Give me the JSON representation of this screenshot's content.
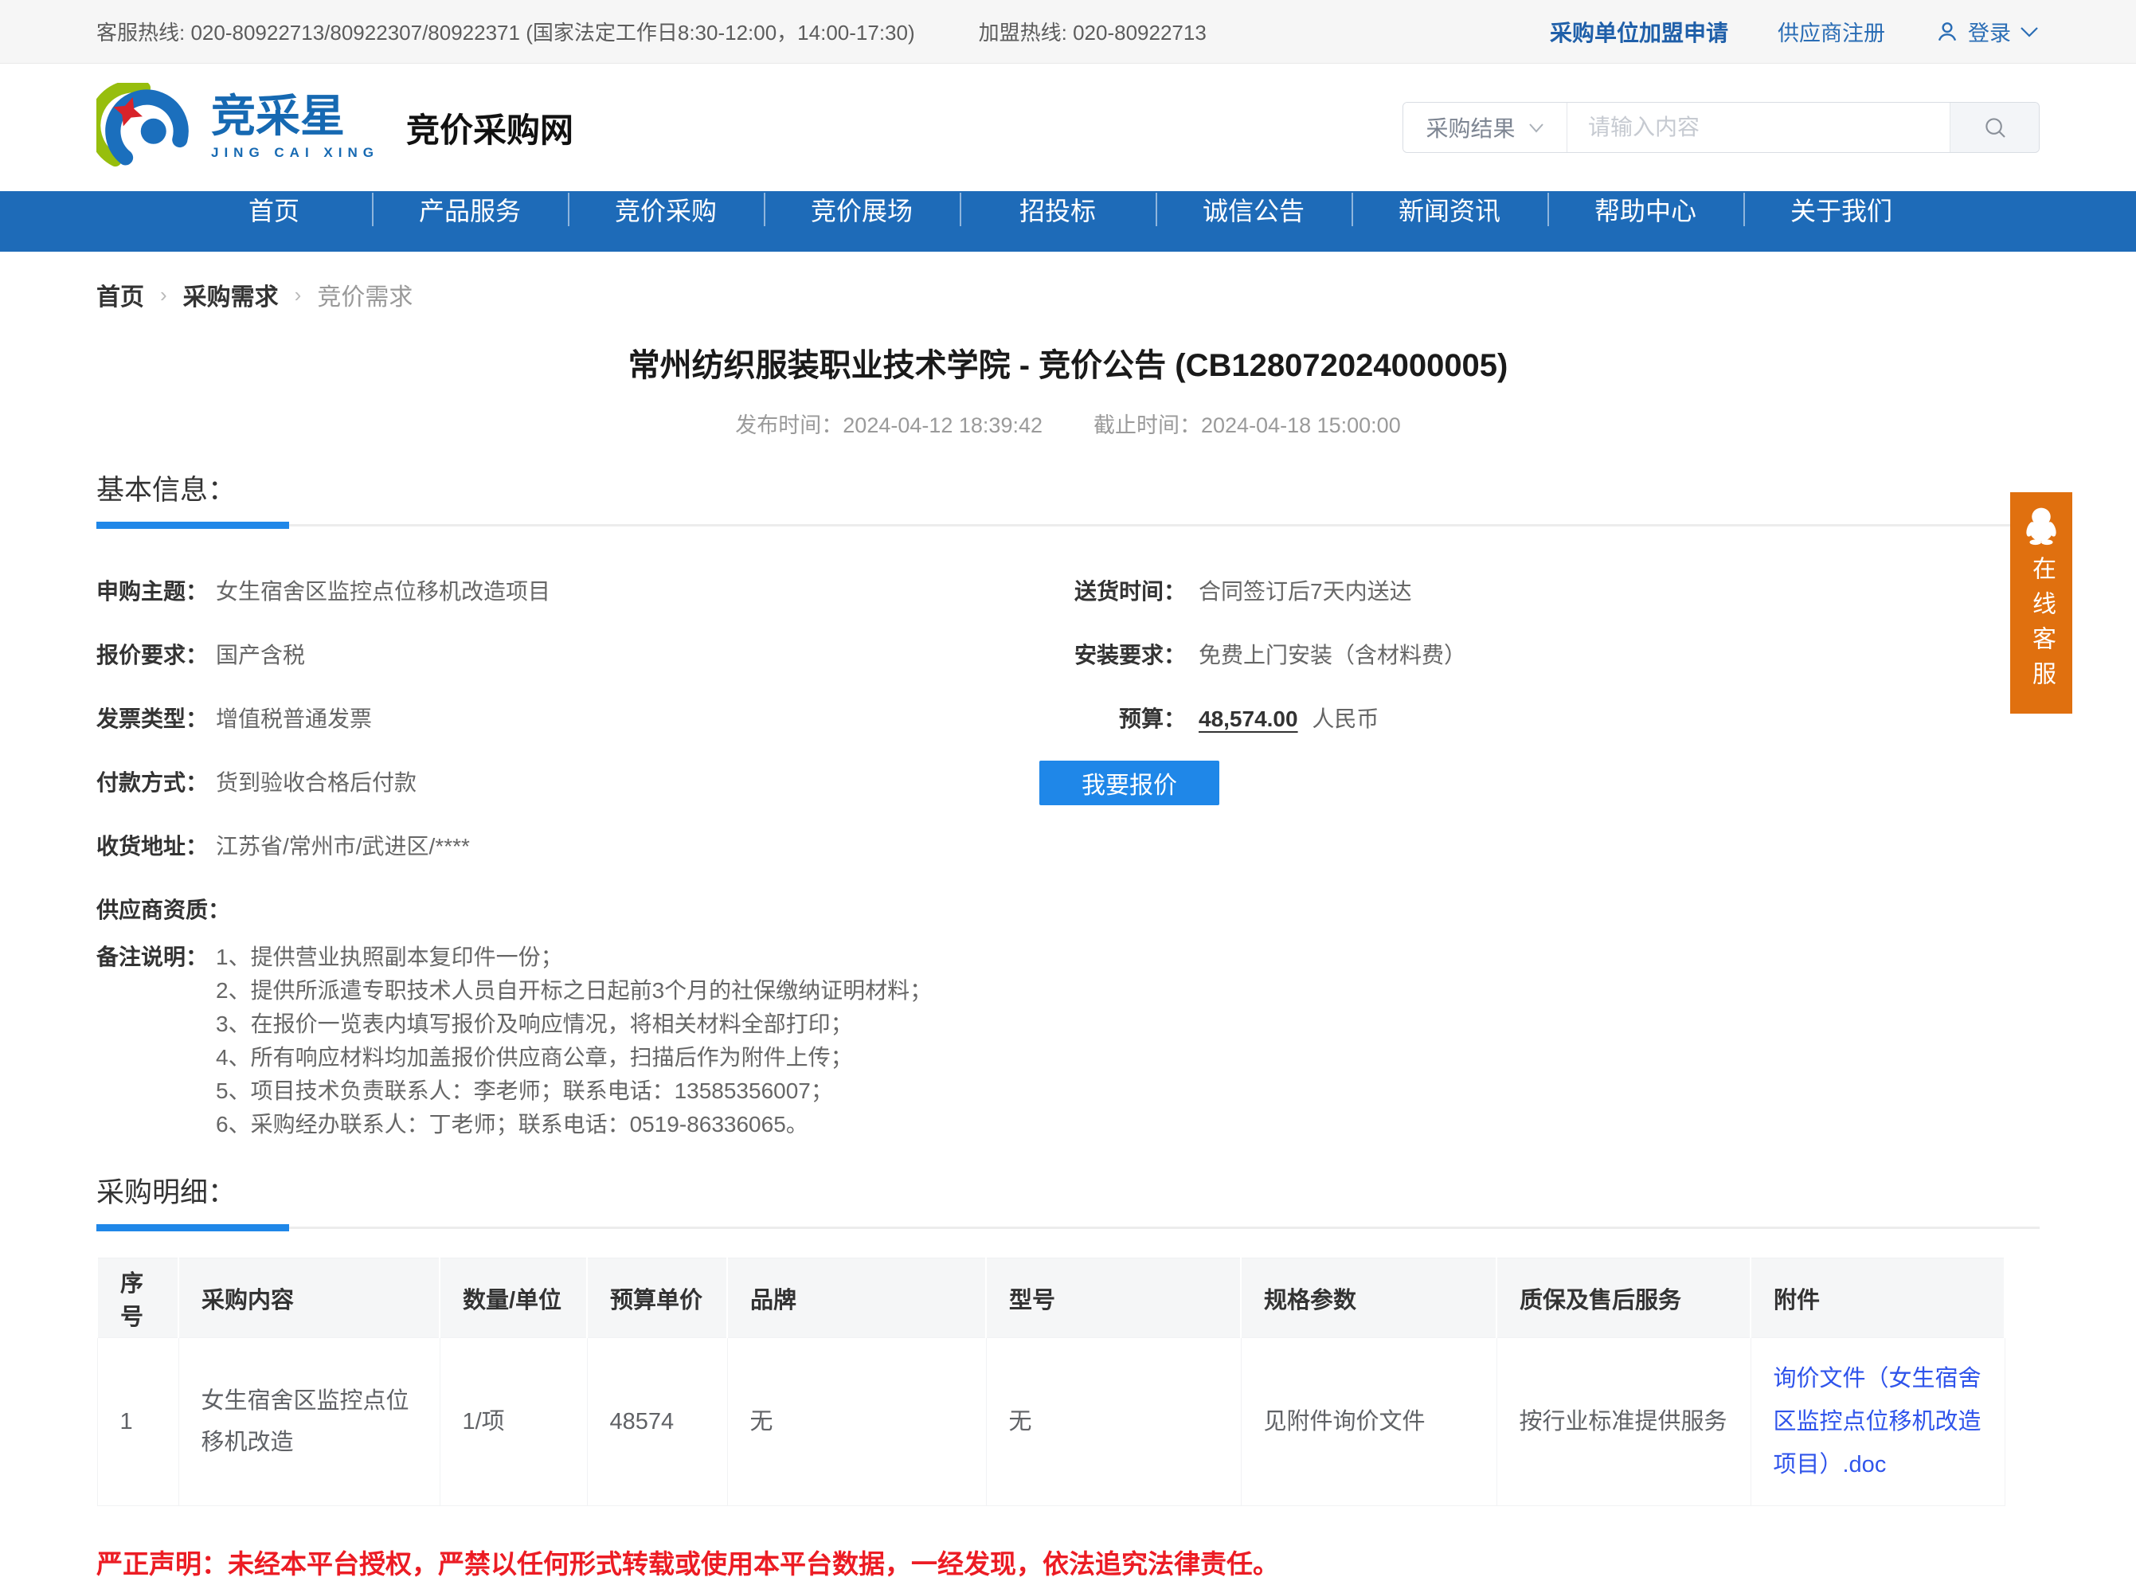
{
  "topbar": {
    "service_hotline": "客服热线: 020-80922713/80922307/80922371 (国家法定工作日8:30-12:00，14:00-17:30)",
    "join_hotline": "加盟热线: 020-80922713",
    "purchaser_join_label": "采购单位加盟申请",
    "supplier_register_label": "供应商注册",
    "login_label": "登录"
  },
  "header": {
    "brand_name": "竞采星",
    "brand_subtitle": "JING CAI XING",
    "site_title": "竞价采购网",
    "search": {
      "category_selected": "采购结果",
      "placeholder": "请输入内容"
    }
  },
  "nav": {
    "items": [
      "首页",
      "产品服务",
      "竞价采购",
      "竞价展场",
      "招投标",
      "诚信公告",
      "新闻资讯",
      "帮助中心",
      "关于我们"
    ]
  },
  "breadcrumb": {
    "home": "首页",
    "level1": "采购需求",
    "current": "竞价需求"
  },
  "notice": {
    "title": "常州纺织服装职业技术学院 - 竞价公告 (CB128072024000005)",
    "publish_label": "发布时间：",
    "publish_value": "2024-04-12 18:39:42",
    "deadline_label": "截止时间：",
    "deadline_value": "2024-04-18 15:00:00"
  },
  "basic_info": {
    "section_title": "基本信息：",
    "fields_left": [
      {
        "label": "申购主题：",
        "value": "女生宿舍区监控点位移机改造项目"
      },
      {
        "label": "报价要求：",
        "value": "国产含税"
      },
      {
        "label": "发票类型：",
        "value": "增值税普通发票"
      },
      {
        "label": "付款方式：",
        "value": "货到验收合格后付款"
      },
      {
        "label": "收货地址：",
        "value": "江苏省/常州市/武进区/****"
      },
      {
        "label": "供应商资质：",
        "value": ""
      }
    ],
    "remark": {
      "label": "备注说明：",
      "lines": [
        "1、提供营业执照副本复印件一份；",
        "2、提供所派遣专职技术人员自开标之日起前3个月的社保缴纳证明材料；",
        "3、在报价一览表内填写报价及响应情况，将相关材料全部打印；",
        "4、所有响应材料均加盖报价供应商公章，扫描后作为附件上传；",
        "5、项目技术负责联系人：李老师；联系电话：13585356007；",
        "6、采购经办联系人：丁老师；联系电话：0519-86336065。"
      ]
    },
    "fields_right": [
      {
        "label": "送货时间：",
        "value": "合同签订后7天内送达"
      },
      {
        "label": "安装要求：",
        "value": "免费上门安装（含材料费）"
      }
    ],
    "budget": {
      "label": "预算：",
      "amount": "48,574.00",
      "currency": "人民币"
    },
    "quote_button_label": "我要报价"
  },
  "procurement_detail": {
    "section_title": "采购明细：",
    "table": {
      "headers": [
        "序号",
        "采购内容",
        "数量/单位",
        "预算单价",
        "品牌",
        "型号",
        "规格参数",
        "质保及售后服务",
        "附件"
      ],
      "rows": [
        {
          "seq": "1",
          "content": "女生宿舍区监控点位移机改造",
          "qty_unit": "1/项",
          "budget_unit_price": "48574",
          "brand": "无",
          "model": "无",
          "spec": "见附件询价文件",
          "warranty": "按行业标准提供服务",
          "attachment": "询价文件（女生宿舍区监控点位移机改造项目）.doc"
        }
      ]
    }
  },
  "disclaimer": "严正声明：未经本平台授权，严禁以任何形式转载或使用本平台数据，一经发现，依法追究法律责任。",
  "customer_service": {
    "label": "在线客服"
  },
  "colors": {
    "nav_blue": "#1e6bb8",
    "accent_blue": "#1f87e8",
    "topbar_link_blue": "#2a6db5",
    "attachment_link_blue": "#2f54eb",
    "service_orange": "#e0700f",
    "warning_red": "#ec1c24"
  }
}
